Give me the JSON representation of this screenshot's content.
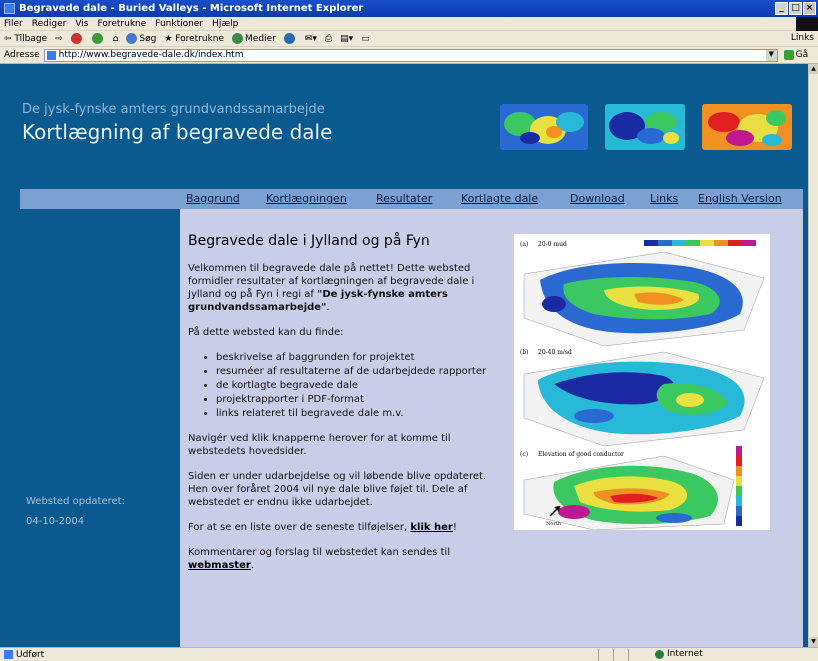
{
  "window": {
    "title": "Begravede dale - Buried Valleys - Microsoft Internet Explorer",
    "btn_min": "_",
    "btn_max": "□",
    "btn_close": "×"
  },
  "menu": {
    "items": [
      "Filer",
      "Rediger",
      "Vis",
      "Foretrukne",
      "Funktioner",
      "Hjælp"
    ]
  },
  "toolbar": {
    "back": "Tilbage",
    "search": "Søg",
    "favorites": "Foretrukne",
    "media": "Medier",
    "links": "Links"
  },
  "address": {
    "label": "Adresse",
    "url": "http://www.begravede-dale.dk/index.htm",
    "go": "Gå"
  },
  "header": {
    "subtitle": "De jysk-fynske amters grundvandssamarbejde",
    "title": "Kortlægning af begravede dale"
  },
  "nav": [
    "Baggrund",
    "Kortlægningen",
    "Resultater",
    "Kortlagte dale",
    "Download",
    "Links",
    "English Version"
  ],
  "sidebar": {
    "updated_label": "Websted opdateret:",
    "updated_date": "04-10-2004"
  },
  "content": {
    "heading": "Begravede dale i Jylland og på Fyn",
    "intro_before": "Velkommen til begravede dale på nettet! Dette websted formidler resultater af kortlægningen af begravede dale i Jylland og på Fyn i regi af ",
    "intro_bold": "\"De jysk-fynske amters grundvandssamarbejde\"",
    "intro_after": ".",
    "find_intro": "På dette websted kan du finde:",
    "bullets": [
      "beskrivelse af baggrunden for projektet",
      "resuméer af resultaterne af de udarbejdede rapporter",
      "de kortlagte begravede dale",
      "projektrapporter i PDF-format",
      "links relateret til begravede dale m.v."
    ],
    "navigate": "Navigér ved klik knapperne herover for at komme til webstedets hovedsider.",
    "under_construction": "Siden er under udarbejdelse og vil løbende blive opdateret. Hen over foråret 2004 vil nye dale blive føjet til. Dele af webstedet er endnu ikke udarbejdet.",
    "latest_before": "For at se en liste over de seneste tilføjelser, ",
    "latest_link": "klik her",
    "latest_after": "!",
    "contact_before": "Kommentarer og forslag til webstedet kan sendes til ",
    "contact_link": "webmaster",
    "contact_after": "."
  },
  "figure": {
    "label_a": "(a)",
    "label_a_text": "20-0 mud",
    "label_b": "(b)",
    "label_b_text": "20-40 m/sd",
    "label_c": "(c)",
    "label_c_text": "Elevation of good conductor",
    "north": "North",
    "colors": [
      "#1a2aa0",
      "#2a6ad0",
      "#28b8d8",
      "#3cc860",
      "#e8e040",
      "#f09020",
      "#e02020",
      "#c01890"
    ]
  },
  "status": {
    "text": "Udført",
    "zone": "Internet"
  }
}
